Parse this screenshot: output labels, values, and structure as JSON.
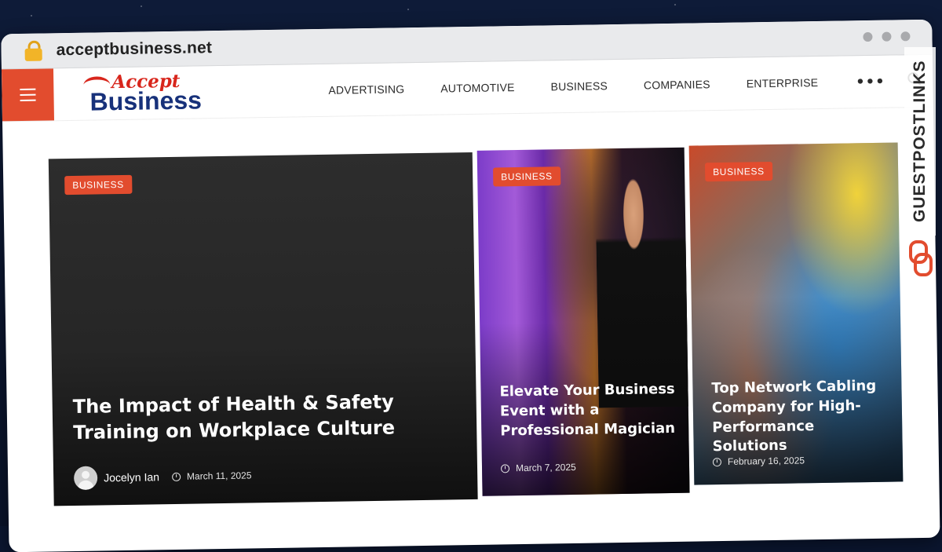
{
  "browser": {
    "url": "acceptbusiness.net"
  },
  "site": {
    "logo_top": "Accept",
    "logo_bottom": "Business",
    "colors": {
      "accent": "#e24c2e",
      "logo_red": "#d8261c",
      "logo_blue": "#17317a"
    },
    "nav": [
      {
        "label": "ADVERTISING"
      },
      {
        "label": "AUTOMOTIVE"
      },
      {
        "label": "BUSINESS"
      },
      {
        "label": "COMPANIES"
      },
      {
        "label": "ENTERPRISE"
      }
    ],
    "more_label": "•••"
  },
  "posts": [
    {
      "category": "BUSINESS",
      "title": "The Impact of Health & Safety Training on Workplace Culture",
      "author": "Jocelyn Ian",
      "date": "March 11, 2025"
    },
    {
      "category": "BUSINESS",
      "title": "Elevate Your Business Event with a Professional Magician",
      "date": "March 7, 2025"
    },
    {
      "category": "BUSINESS",
      "title": "Top Network Cabling Company for High-Performance Solutions",
      "date": "February 16, 2025"
    }
  ],
  "watermark": {
    "text": "GUESTPOSTLINKS"
  }
}
